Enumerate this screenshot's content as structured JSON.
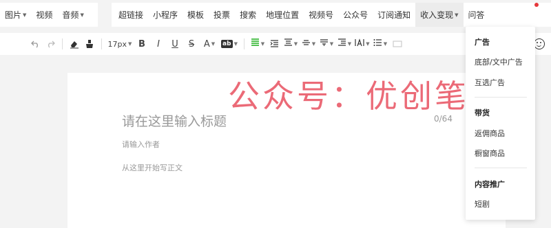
{
  "insert_bar": {
    "left_items": [
      {
        "label": "图片",
        "has_caret": true
      },
      {
        "label": "视频",
        "has_caret": false
      },
      {
        "label": "音频",
        "has_caret": true
      }
    ],
    "right_items": [
      {
        "label": "超链接"
      },
      {
        "label": "小程序"
      },
      {
        "label": "模板"
      },
      {
        "label": "投票"
      },
      {
        "label": "搜索"
      },
      {
        "label": "地理位置"
      },
      {
        "label": "视频号"
      },
      {
        "label": "公众号"
      },
      {
        "label": "订阅通知"
      },
      {
        "label": "收入变现",
        "has_caret": true,
        "active": true
      },
      {
        "label": "问答"
      }
    ]
  },
  "format_bar": {
    "font_size": "17px",
    "bold": "B",
    "italic": "I",
    "underline": "U",
    "strikethrough": "S",
    "font_color": "A",
    "bg_color": "ab"
  },
  "editor": {
    "title_placeholder": "请在这里输入标题",
    "title_count": "0/64",
    "author_placeholder": "请输入作者",
    "body_placeholder": "从这里开始写正文"
  },
  "watermark": "公众号：优创笔记",
  "dropdown": {
    "sections": [
      {
        "heading": "广告",
        "items": [
          "底部/文中广告",
          "互选广告"
        ]
      },
      {
        "heading": "带货",
        "items": [
          "返佣商品",
          "橱窗商品"
        ]
      },
      {
        "heading": "内容推广",
        "items": [
          "短剧"
        ]
      }
    ]
  },
  "colors": {
    "accent_green": "#1aad19",
    "watermark_red": "#e8505f",
    "notification_dot": "#e5383b"
  }
}
